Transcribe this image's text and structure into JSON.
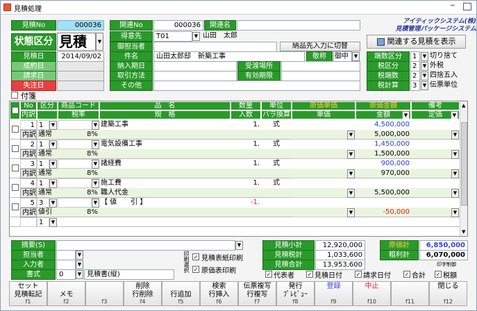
{
  "window": {
    "title": "見積処理",
    "minimize": "─",
    "close": "■"
  },
  "company": {
    "line1": "アイティックシステム(株)",
    "line2": "見積管理パッケージシステム"
  },
  "header": {
    "quote_no_label": "見積No",
    "quote_no": "000036",
    "related_no_label": "関連No",
    "related_no": "000036",
    "related_name_label": "関連名",
    "related_name": "",
    "status_label": "状態区分",
    "status_value": "見積",
    "quote_date_label": "見積日",
    "quote_date": "2014/09/02",
    "contract_date_label": "成約日",
    "billing_date_label": "請求日",
    "lost_date_label": "失注日",
    "customer_label": "得意先",
    "customer_code": "T01",
    "customer_name": "山田　太郎",
    "contact_label": "御担当者",
    "contact": "",
    "delivery_btn": "納品先入力に切替",
    "subject_label": "件名",
    "subject": "山田太郎邸　新築工事",
    "honorific_label": "敬称",
    "honorific": "御中",
    "deadline_label": "納入期日",
    "delivery_place_label": "受渡場所",
    "payment_label": "取引方法",
    "validity_label": "有効期限",
    "other_label": "その他",
    "related_btn": "関連する見積を表示",
    "fraction_label": "端数区分",
    "fraction_code": "1",
    "fraction_value": "切り捨て",
    "tax_div_label": "税区分",
    "tax_div_code": "2",
    "tax_div_value": "外税",
    "tax_fraction_label": "税端数",
    "tax_fraction_code": "2",
    "tax_fraction_value": "四捨五入",
    "tax_calc_label": "税計算",
    "tax_calc_code": "3",
    "tax_calc_value": "伝票単位",
    "attach_label": "付箋"
  },
  "grid": {
    "headers": {
      "no": "No",
      "kubun": "区分",
      "uchiwake": "内訳",
      "code": "商品コード",
      "tax_rate": "税率",
      "item": "品　名",
      "spec": "規　格",
      "qty": "数量",
      "irisu": "入数",
      "bara": "バラ換算",
      "unit": "単位",
      "cost_unit": "原価単価",
      "unit_price": "単価",
      "cost_amount": "原価金額",
      "amount": "金額",
      "note": "備考",
      "fixed": "定価"
    },
    "rows": [
      {
        "no": "1",
        "kubun": "1",
        "uchi": "内訳",
        "kubun_name": "通常",
        "tax": "8%",
        "item": "建築工事",
        "spec": "",
        "qty": "1.",
        "unit": "式",
        "cost_amount": "4,500,000",
        "amount": "5,000,000"
      },
      {
        "no": "2",
        "kubun": "1",
        "uchi": "内訳",
        "kubun_name": "通常",
        "tax": "8%",
        "item": "電気設備工事",
        "spec": "",
        "qty": "1.",
        "unit": "式",
        "cost_amount": "1,450,000",
        "amount": "1,500,000"
      },
      {
        "no": "3",
        "kubun": "1",
        "uchi": "内訳",
        "kubun_name": "通常",
        "tax": "8%",
        "item": "諸経費",
        "spec": "",
        "qty": "1.",
        "unit": "式",
        "cost_amount": "900,000",
        "amount": "970,000"
      },
      {
        "no": "4",
        "kubun": "1",
        "uchi": "内訳",
        "kubun_name": "通常",
        "tax": "8%",
        "item": "施工費",
        "spec": "職人代金",
        "qty": "1.",
        "unit": "式",
        "cost_amount": "",
        "amount": "5,500,000"
      },
      {
        "no": "5",
        "kubun": "3",
        "uchi": "内訳",
        "kubun_name": "値引",
        "tax": "8%",
        "item": "【 値　　引 】",
        "spec": "",
        "qty": "-1.",
        "unit": "",
        "cost_amount": "",
        "amount": "-50,000"
      },
      {
        "no": "",
        "kubun": "1",
        "uchi": "",
        "kubun_name": "",
        "tax": "",
        "item": "",
        "spec": "",
        "qty": "",
        "unit": "",
        "cost_amount": "",
        "amount": ""
      }
    ]
  },
  "footer": {
    "summary_label": "摘要(S)",
    "staff_label": "担当者",
    "inputter_label": "入力者",
    "format_label": "書式",
    "format_code": "0",
    "format_value": "見積書(縦)",
    "print_select": "印刷選択",
    "print_cover": "見積表紙印刷",
    "print_cost": "原価表印刷",
    "subtotal_label": "見積小計",
    "subtotal": "12,920,000",
    "tax_label": "見積税計",
    "tax": "1,033,600",
    "total_label": "見積合計",
    "total": "13,953,600",
    "cost_total_label": "原価計",
    "cost_total": "6,850,000",
    "gross_label": "粗利計",
    "gross": "6,070,000",
    "print_control": "印字制御",
    "chk_rep": "代表者",
    "chk_date": "見積日付",
    "chk_bill": "請求日付",
    "chk_sum": "合計",
    "chk_tax": "税額"
  },
  "fkeys": [
    {
      "top": "セット",
      "bot": "見積転記",
      "fn": "f1"
    },
    {
      "top": "",
      "bot": "メモ",
      "fn": "f2"
    },
    {
      "top": "",
      "bot": "",
      "fn": "f3"
    },
    {
      "top": "削除",
      "bot": "行削除",
      "fn": "f4"
    },
    {
      "top": "",
      "bot": "行追加",
      "fn": "f5"
    },
    {
      "top": "検索",
      "bot": "行挿入",
      "fn": "f6"
    },
    {
      "top": "伝票複写",
      "bot": "行複写",
      "fn": "f7"
    },
    {
      "top": "発行",
      "bot": "ﾌﾟﾚﾋﾞｭｰ",
      "fn": "f8"
    },
    {
      "top": "登録",
      "bot": "",
      "fn": "f9"
    },
    {
      "top": "中止",
      "bot": "",
      "fn": "f10"
    },
    {
      "top": "",
      "bot": "",
      "fn": "f11"
    },
    {
      "top": "閉じる",
      "bot": "",
      "fn": "f12"
    }
  ]
}
